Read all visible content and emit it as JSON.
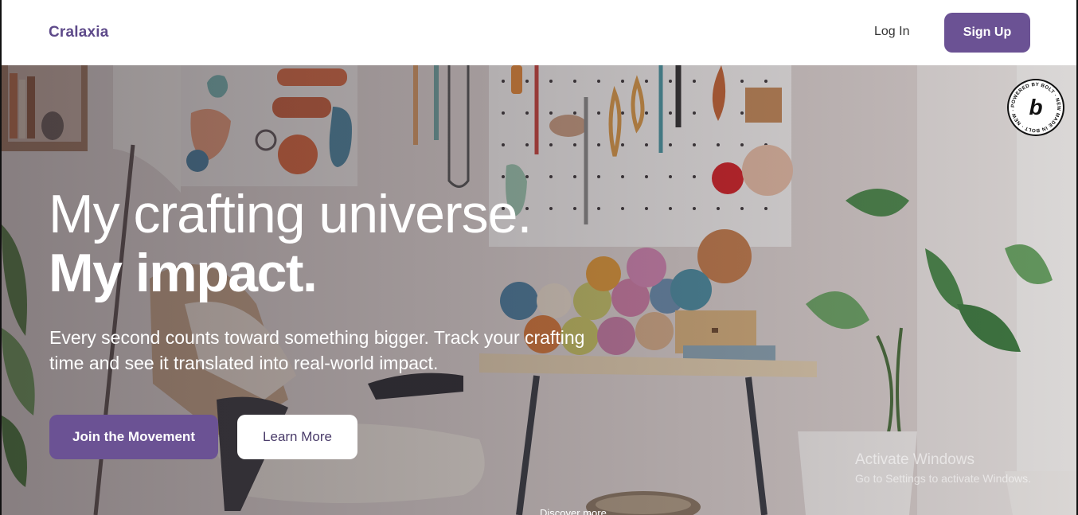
{
  "header": {
    "brand": "Cralaxia",
    "login_label": "Log In",
    "signup_label": "Sign Up"
  },
  "hero": {
    "title_line1": "My crafting universe.",
    "title_line2": "My impact.",
    "subtitle": "Every second counts toward something bigger. Track your crafting time and see it translated into real-world impact.",
    "primary_cta": "Join the Movement",
    "secondary_cta": "Learn More",
    "discover_label": "Discover more"
  },
  "badge": {
    "ring_text": "POWERED BY BOLT · NEW MADE IN BOLT · NEW ·",
    "logo_letter": "b"
  },
  "windows_watermark": {
    "title": "Activate Windows",
    "subtitle": "Go to Settings to activate Windows."
  },
  "colors": {
    "brand_purple": "#6b5294",
    "brand_text": "#5e4a8a"
  }
}
